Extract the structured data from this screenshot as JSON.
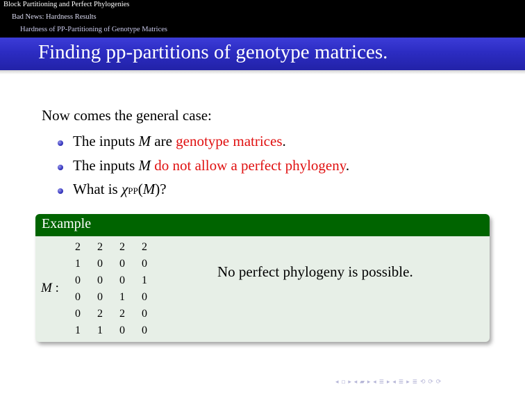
{
  "nav": {
    "section": "Block Partitioning and Perfect Phylogenies",
    "subsection": "Bad News: Hardness Results",
    "subsubsection": "Hardness of PP-Partitioning of Genotype Matrices"
  },
  "slide": {
    "title": "Finding pp-partitions of genotype matrices.",
    "intro": "Now comes the general case:",
    "bullets": [
      {
        "pre": "The inputs ",
        "var": "M",
        "mid": " are ",
        "highlight": "genotype matrices",
        "post": "."
      },
      {
        "pre": "The inputs ",
        "var": "M",
        "mid": " ",
        "highlight": "do not allow a perfect phylogeny",
        "post": "."
      },
      {
        "pre": "What is ",
        "chi": "χ",
        "sub": "PP",
        "open": "(",
        "var": "M",
        "close": ")?"
      }
    ]
  },
  "example": {
    "title": "Example",
    "matrix_label": "M",
    "colon": " :",
    "matrix": [
      [
        "2",
        "2",
        "2",
        "2"
      ],
      [
        "1",
        "0",
        "0",
        "0"
      ],
      [
        "0",
        "0",
        "0",
        "1"
      ],
      [
        "0",
        "0",
        "1",
        "0"
      ],
      [
        "0",
        "2",
        "2",
        "0"
      ],
      [
        "1",
        "1",
        "0",
        "0"
      ]
    ],
    "message": "No perfect phylogeny is possible."
  },
  "footer": {
    "nav_symbols": "◂ ▫ ▸  ◂ ▰ ▸  ◂ ≣ ▸  ◂ ≣ ▸   ≣   ⟲ ⟳ ⟳"
  },
  "colors": {
    "title_bar": "#2c2cc2",
    "highlight": "#e01010",
    "block_head": "#006400",
    "block_body": "#e7efe7"
  }
}
